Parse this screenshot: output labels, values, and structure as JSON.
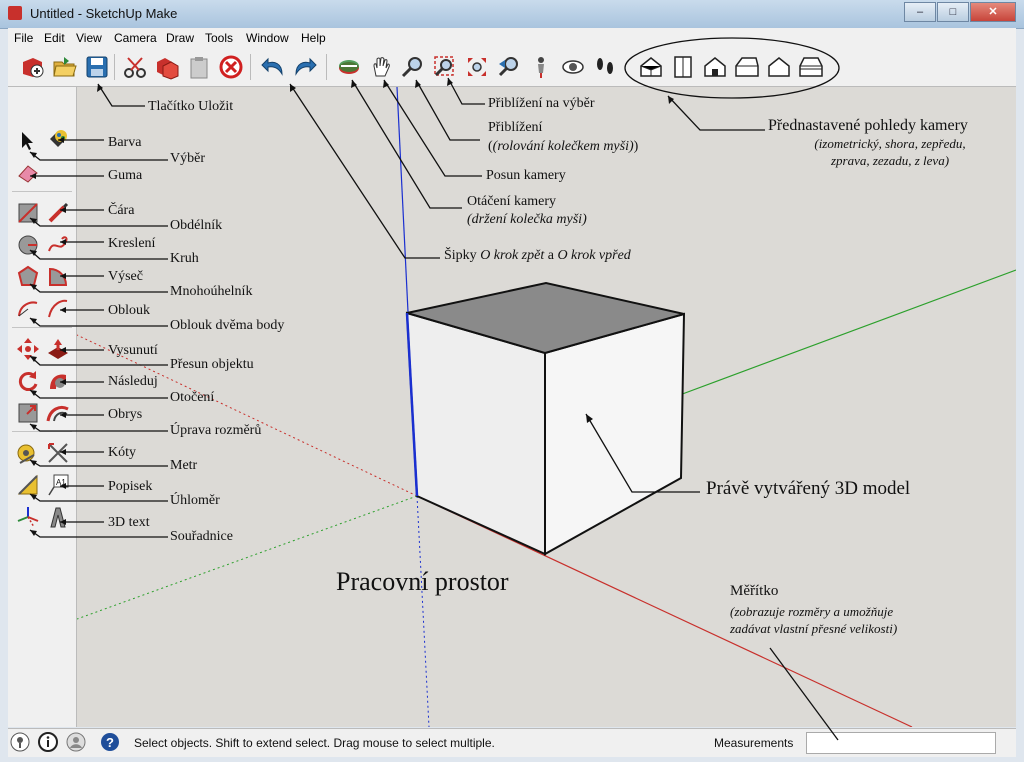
{
  "window": {
    "title": "Untitled - SketchUp Make",
    "minimize": "‒",
    "maximize": "□",
    "close": "✕"
  },
  "menu": [
    "File",
    "Edit",
    "View",
    "Camera",
    "Draw",
    "Tools",
    "Window",
    "Help"
  ],
  "toolbar": {
    "icons": [
      "getting-started-icon",
      "open-icon",
      "save-icon",
      "cut-icon",
      "copy-icon",
      "paste-icon",
      "erase-icon",
      "undo-icon",
      "redo-icon",
      "orbit-icon",
      "pan-icon",
      "zoom-icon",
      "zoom-window-icon",
      "zoom-extents-icon",
      "previous-view-icon",
      "position-camera-icon",
      "look-around-icon",
      "walk-icon",
      "iso-view-icon",
      "top-view-icon",
      "front-view-icon",
      "right-view-icon",
      "back-view-icon",
      "left-view-icon"
    ]
  },
  "annotations": {
    "save": "Tlačítko Uložit",
    "zoom_window": "Přiblížení na výběr",
    "zoom": "Přiblížení",
    "zoom_hint": "(rolování kolečkem myši)",
    "pan": "Posun kamery",
    "orbit": "Otáčení kamery",
    "orbit_hint": "(držení kolečka myši)",
    "undo_redo_a": "Šipky ",
    "undo_redo_b": "O krok zpět",
    "undo_redo_c": " a ",
    "undo_redo_d": "O krok vpřed",
    "views": "Přednastavené pohledy kamery",
    "views_hint_1": "(izometrický, shora, zepředu,",
    "views_hint_2": "zprava, zezadu, z leva)",
    "paint": "Barva",
    "select": "Výběr",
    "eraser": "Guma",
    "line": "Čára",
    "rectangle": "Obdélník",
    "freehand": "Kreslení",
    "circle": "Kruh",
    "pie": "Výseč",
    "polygon": "Mnohoúhelník",
    "arc": "Oblouk",
    "arc2": "Oblouk dvěma body",
    "pushpull": "Vysunutí",
    "move": "Přesun objektu",
    "followme": "Následuj",
    "rotate": "Otočení",
    "offset": "Obrys",
    "scale": "Úprava rozměrů",
    "dimensions": "Kóty",
    "tape": "Metr",
    "text": "Popisek",
    "protractor": "Úhloměr",
    "text3d": "3D text",
    "axes": "Souřadnice",
    "model": "Právě vytvářený 3D model",
    "workspace": "Pracovní prostor",
    "measure": "Měřítko",
    "measure_hint_1": "(zobrazuje rozměry a umožňuje",
    "measure_hint_2": "zadávat vlastní přesné velikosti)"
  },
  "statusbar": {
    "message": "Select objects. Shift to extend select. Drag mouse to select multiple.",
    "measurements_label": "Measurements",
    "measurements_value": ""
  },
  "colors": {
    "axis_red": "#c8302c",
    "axis_green": "#2ca02c",
    "axis_blue": "#1a2fd0",
    "canvas": "#dcdad6"
  }
}
